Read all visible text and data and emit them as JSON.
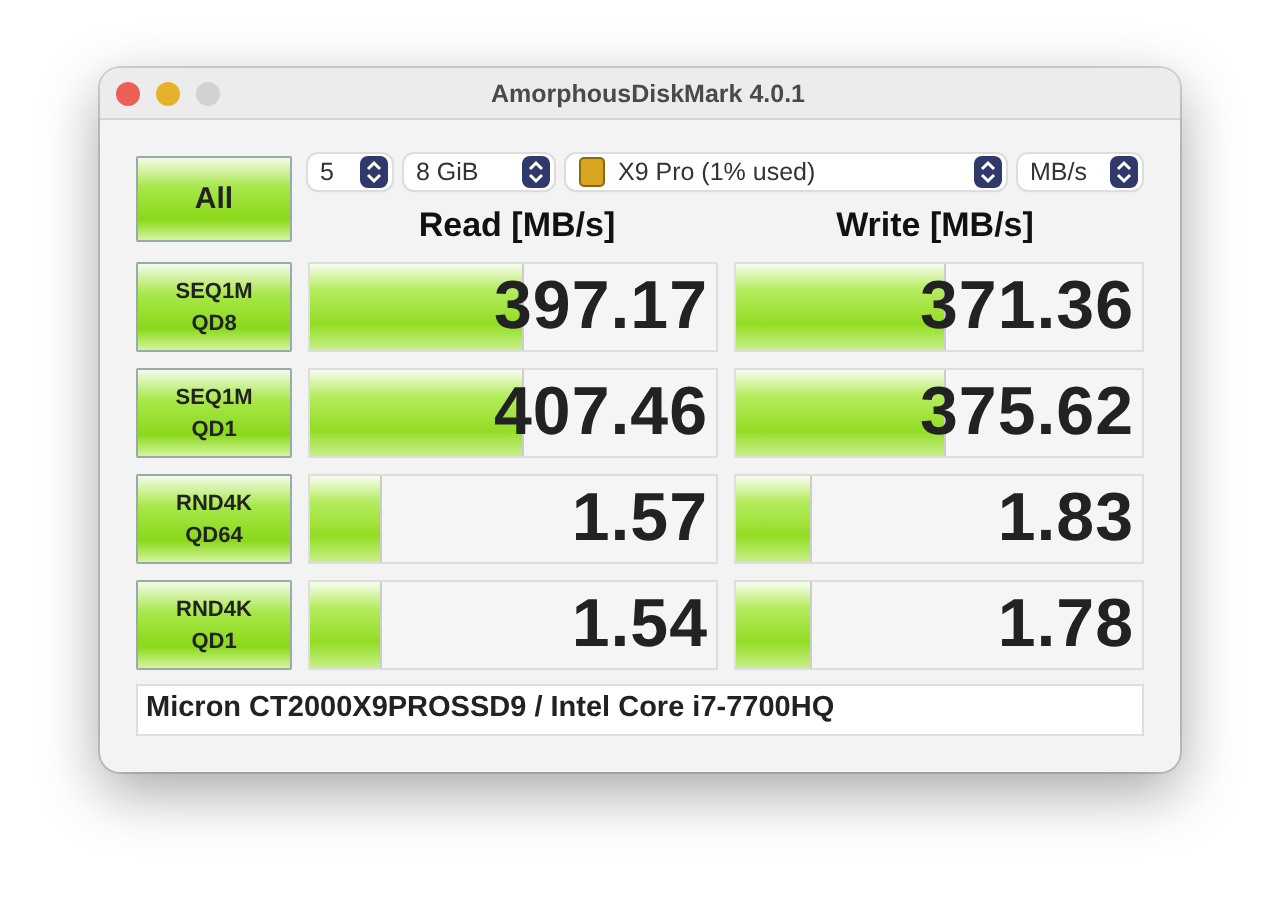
{
  "window": {
    "title": "AmorphousDiskMark 4.0.1"
  },
  "all_button": {
    "label": "All"
  },
  "selectors": [
    {
      "kind": "count",
      "value": "5"
    },
    {
      "kind": "size",
      "value": "8 GiB"
    },
    {
      "kind": "drive",
      "value": "X9 Pro (1% used)"
    },
    {
      "kind": "unit",
      "value": "MB/s"
    }
  ],
  "headers": {
    "read": "Read [MB/s]",
    "write": "Write [MB/s]"
  },
  "tests": [
    {
      "label": "SEQ1M\nQD8",
      "read": {
        "reading": "397.17",
        "level": 0.52
      },
      "write": {
        "reading": "371.36",
        "level": 0.51
      }
    },
    {
      "label": "SEQ1M\nQD1",
      "read": {
        "reading": "407.46",
        "level": 0.52
      },
      "write": {
        "reading": "375.62",
        "level": 0.51
      }
    },
    {
      "label": "RND4K\nQD64",
      "read": {
        "reading": "1.57",
        "level": 0.17
      },
      "write": {
        "reading": "1.83",
        "level": 0.18
      }
    },
    {
      "label": "RND4K\nQD1",
      "read": {
        "reading": "1.54",
        "level": 0.17
      },
      "write": {
        "reading": "1.78",
        "level": 0.18
      }
    }
  ],
  "comment": {
    "value": "Micron CT2000X9PROSSD9 / Intel Core i7-7700HQ"
  }
}
